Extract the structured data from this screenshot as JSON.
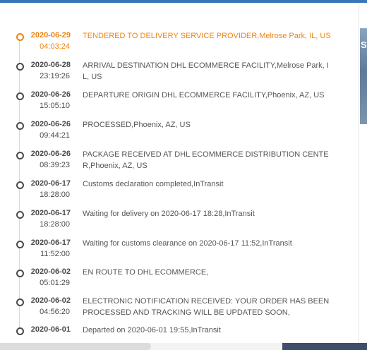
{
  "tracking": {
    "events": [
      {
        "date": "2020-06-29",
        "time": "04:03:24",
        "description": "TENDERED TO DELIVERY SERVICE PROVIDER,Melrose Park, IL, US",
        "current": true
      },
      {
        "date": "2020-06-28",
        "time": "23:19:26",
        "description": "ARRIVAL DESTINATION DHL ECOMMERCE FACILITY,Melrose Park, IL, US",
        "current": false
      },
      {
        "date": "2020-06-26",
        "time": "15:05:10",
        "description": "DEPARTURE ORIGIN DHL ECOMMERCE FACILITY,Phoenix, AZ, US",
        "current": false
      },
      {
        "date": "2020-06-26",
        "time": "09:44:21",
        "description": "PROCESSED,Phoenix, AZ, US",
        "current": false
      },
      {
        "date": "2020-06-26",
        "time": "08:39:23",
        "description": "PACKAGE RECEIVED AT DHL ECOMMERCE DISTRIBUTION CENTER,Phoenix, AZ, US",
        "current": false
      },
      {
        "date": "2020-06-17",
        "time": "18:28:00",
        "description": "Customs declaration completed,InTransit",
        "current": false
      },
      {
        "date": "2020-06-17",
        "time": "18:28:00",
        "description": "Waiting for delivery on 2020-06-17 18:28,InTransit",
        "current": false
      },
      {
        "date": "2020-06-17",
        "time": "11:52:00",
        "description": "Waiting for customs clearance on 2020-06-17 11:52,InTransit",
        "current": false
      },
      {
        "date": "2020-06-02",
        "time": "05:01:29",
        "description": "EN ROUTE TO DHL ECOMMERCE,",
        "current": false
      },
      {
        "date": "2020-06-02",
        "time": "04:56:20",
        "description": "ELECTRONIC NOTIFICATION RECEIVED: YOUR ORDER HAS BEEN PROCESSED AND TRACKING WILL BE UPDATED SOON,",
        "current": false
      },
      {
        "date": "2020-06-01",
        "time": "",
        "description": "Departed on 2020-06-01 19:55,InTransit",
        "current": false
      }
    ]
  },
  "side_panel": {
    "glyph": "S"
  },
  "colors": {
    "accent": "#f0830f",
    "text": "#555555",
    "header": "#3a77b8"
  }
}
